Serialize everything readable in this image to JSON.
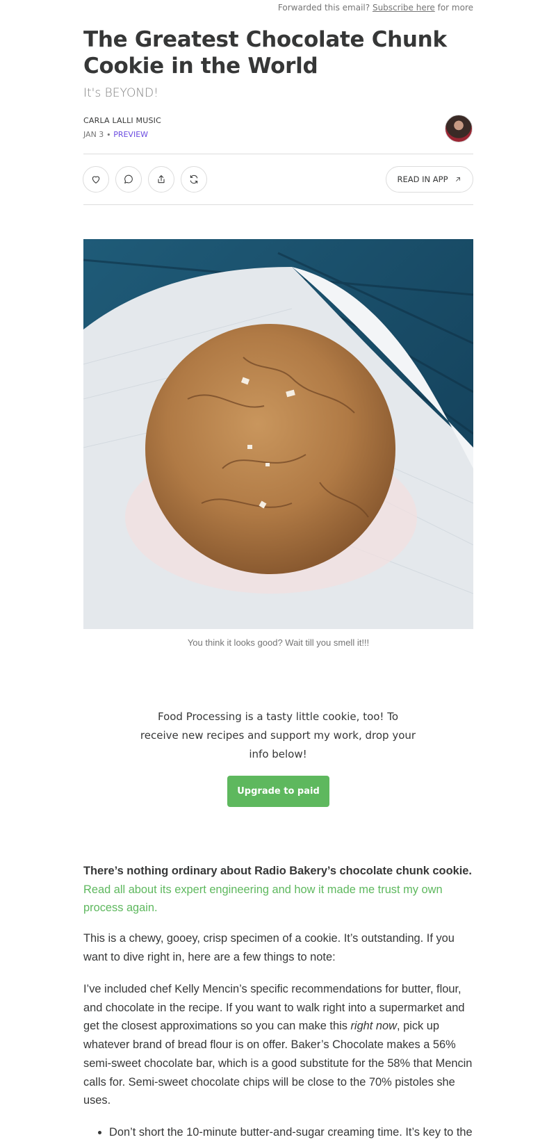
{
  "header": {
    "forward_text": "Forwarded this email?",
    "subscribe_link": "Subscribe here",
    "forward_suffix": "for more"
  },
  "post": {
    "title": "The Greatest Chocolate Chunk Cookie in the World",
    "subtitle": "It's BEYOND!",
    "author": "CARLA LALLI MUSIC",
    "date": "JAN 3",
    "separator": "∙",
    "preview_label": "PREVIEW"
  },
  "actions": {
    "read_in_app": "READ IN APP",
    "icons": [
      "heart-icon",
      "comment-icon",
      "share-icon",
      "restack-icon",
      "arrow-up-right-icon"
    ]
  },
  "image": {
    "caption": "You think it looks good? Wait till you smell it!!!"
  },
  "cta": {
    "text": "Food Processing is a tasty little cookie, too! To receive new recipes and support my work, drop your info below!",
    "button": "Upgrade to paid",
    "button_color": "#5eb85e"
  },
  "body": {
    "lead_bold": "There’s nothing ordinary about Radio Bakery’s chocolate chunk cookie.",
    "lead_link": "Read all about its expert engineering and how it made me trust my own process again.",
    "p1": "This is a chewy, gooey, crisp specimen of a cookie. It’s outstanding. If you want to dive right in, here are a few things to note:",
    "p2_before": "I’ve included chef Kelly Mencin’s specific recommendations for butter, flour, and chocolate in the recipe. If you want to walk right into a supermarket and get the closest approximations so you can make this ",
    "p2_italic": "right now",
    "p2_after": ", pick up whatever brand of bread flour is on offer. Baker’s Chocolate makes a 56% semi-sweet chocolate bar, which is a good substitute for the 58% that Mencin calls for. Semi-sweet chocolate chips will be close to the 70% pistoles she uses.",
    "bullet1": "Don’t short the 10-minute butter-and-sugar creaming time. It’s key to the"
  }
}
